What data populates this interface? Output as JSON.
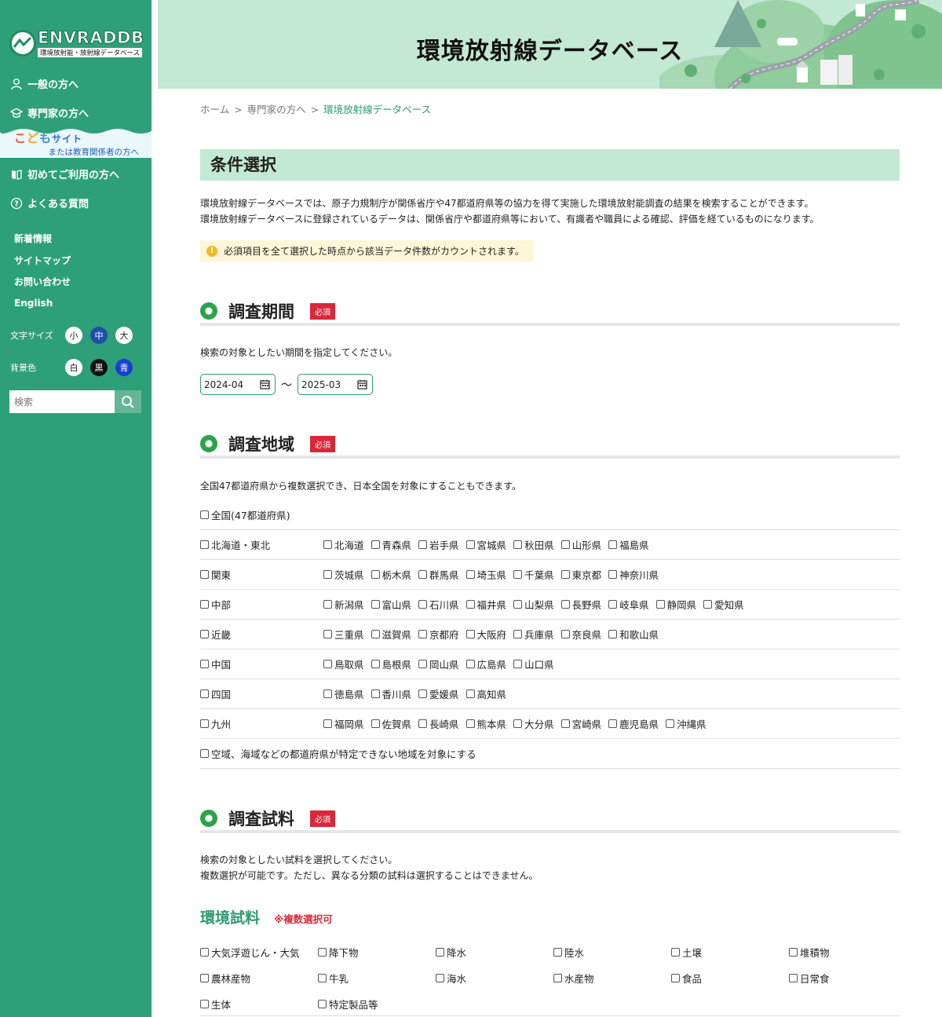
{
  "brand": {
    "logo_text": "ENVRADDB",
    "logo_sub": "環境放射能・放射線データベース"
  },
  "sidebar": {
    "nav_main": [
      {
        "label": "一般の方へ",
        "icon": "user-icon"
      },
      {
        "label": "専門家の方へ",
        "icon": "graduation-cap-icon"
      }
    ],
    "kodomo": {
      "title_a": "こ",
      "title_b": "ど",
      "title_c": "も",
      "title_d": "サイト",
      "subtitle": "または教育関係者の方へ"
    },
    "nav_main2": [
      {
        "label": "初めてご利用の方へ",
        "icon": "book-icon"
      },
      {
        "label": "よくある質問",
        "icon": "question-icon"
      }
    ],
    "nav_small": [
      "新着情報",
      "サイトマップ",
      "お問い合わせ",
      "English"
    ],
    "font_size": {
      "label": "文字サイズ",
      "options": [
        "小",
        "中",
        "大"
      ],
      "selected": "中"
    },
    "bg_color": {
      "label": "背景色",
      "options": [
        "白",
        "黒",
        "青"
      ]
    },
    "search": {
      "placeholder": "検索"
    }
  },
  "header": {
    "title": "環境放射線データベース"
  },
  "breadcrumb": [
    "ホーム",
    "専門家の方へ",
    "環境放射線データベース"
  ],
  "breadcrumb_sep": ">",
  "conditions": {
    "title": "条件選択",
    "intro": [
      "環境放射線データベースでは、原子力規制庁が関係省庁や47都道府県等の協力を得て実施した環境放射能調査の結果を検索することができます。",
      "環境放射線データベースに登録されているデータは、関係省庁や都道府県等において、有識者や職員による確認、評価を経ているものになります。"
    ],
    "notice": "必須項目を全て選択した時点から該当データ件数がカウントされます。"
  },
  "required_label": "必須",
  "period": {
    "title": "調査期間",
    "desc": "検索の対象としたい期間を指定してください。",
    "from": "2024-04",
    "separator": "〜",
    "to": "2025-03"
  },
  "region": {
    "title": "調査地域",
    "desc": "全国47都道府県から複数選択でき、日本全国を対象にすることもできます。",
    "all": "全国(47都道府県)",
    "rows": [
      {
        "name": "北海道・東北",
        "prefs": [
          "北海道",
          "青森県",
          "岩手県",
          "宮城県",
          "秋田県",
          "山形県",
          "福島県"
        ]
      },
      {
        "name": "関東",
        "prefs": [
          "茨城県",
          "栃木県",
          "群馬県",
          "埼玉県",
          "千葉県",
          "東京都",
          "神奈川県"
        ]
      },
      {
        "name": "中部",
        "prefs": [
          "新潟県",
          "富山県",
          "石川県",
          "福井県",
          "山梨県",
          "長野県",
          "岐阜県",
          "静岡県",
          "愛知県"
        ]
      },
      {
        "name": "近畿",
        "prefs": [
          "三重県",
          "滋賀県",
          "京都府",
          "大阪府",
          "兵庫県",
          "奈良県",
          "和歌山県"
        ]
      },
      {
        "name": "中国",
        "prefs": [
          "鳥取県",
          "島根県",
          "岡山県",
          "広島県",
          "山口県"
        ]
      },
      {
        "name": "四国",
        "prefs": [
          "徳島県",
          "香川県",
          "愛媛県",
          "高知県"
        ]
      },
      {
        "name": "九州",
        "prefs": [
          "福岡県",
          "佐賀県",
          "長崎県",
          "熊本県",
          "大分県",
          "宮崎県",
          "鹿児島県",
          "沖縄県"
        ]
      }
    ],
    "unspecified": "空域、海域などの都道府県が特定できない地域を対象にする"
  },
  "sample": {
    "title": "調査試料",
    "desc": [
      "検索の対象としたい試料を選択してください。",
      "複数選択が可能です。ただし、異なる分類の試料は選択することはできません。"
    ],
    "env_title": "環境試料",
    "env_note": "※複数選択可",
    "items": [
      [
        "大気浮遊じん・大気",
        "降下物",
        "降水",
        "陸水",
        "土壌",
        "堆積物"
      ],
      [
        "農林産物",
        "牛乳",
        "海水",
        "水産物",
        "食品",
        "日常食"
      ],
      [
        "生体",
        "特定製品等"
      ]
    ]
  },
  "colors": {
    "sidebar": "#2ea079",
    "header": "#c3e8d4",
    "accent": "#2e9b6e",
    "required": "#d9283a"
  }
}
